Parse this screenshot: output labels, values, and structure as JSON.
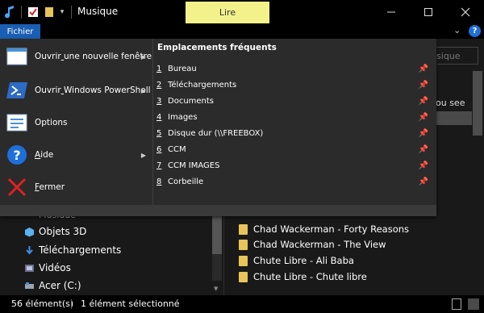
{
  "window": {
    "title": "Musique",
    "contextual_tab": "Lire",
    "icons": [
      "music-note-icon",
      "properties-icon",
      "new-folder-icon",
      "customize-quick-access-icon"
    ]
  },
  "ribbon": {
    "file_tab": "Fichier",
    "help": "?"
  },
  "file_menu": {
    "items": [
      {
        "label": "Ouvrir une nouvelle fenêtre",
        "has_submenu": true
      },
      {
        "label": "Ouvrir Windows PowerShell",
        "has_submenu": true
      },
      {
        "label": "Options",
        "has_submenu": false
      },
      {
        "label": "Aide",
        "has_submenu": true
      },
      {
        "label": "Fermer",
        "has_submenu": false
      }
    ],
    "frequent_title": "Emplacements fréquents",
    "frequent_places": [
      {
        "num": "1",
        "label": "Bureau"
      },
      {
        "num": "2",
        "label": "Téléchargements"
      },
      {
        "num": "3",
        "label": "Documents"
      },
      {
        "num": "4",
        "label": "Images"
      },
      {
        "num": "5",
        "label": "Disque dur (\\\\FREEBOX)"
      },
      {
        "num": "6",
        "label": "CCM"
      },
      {
        "num": "7",
        "label": "CCM IMAGES"
      },
      {
        "num": "8",
        "label": "Corbeille"
      }
    ]
  },
  "background": {
    "search_placeholder": "Rechercher dans : Musique",
    "search_visible": "isique",
    "partial_text": "ou see",
    "partial_nav": "Musique"
  },
  "nav_pane": {
    "items": [
      {
        "label": "Objets 3D",
        "icon": "cube-icon"
      },
      {
        "label": "Téléchargements",
        "icon": "download-icon"
      },
      {
        "label": "Vidéos",
        "icon": "video-icon"
      },
      {
        "label": "Acer (C:)",
        "icon": "drive-icon"
      }
    ]
  },
  "files": {
    "items": [
      "Chad Wackerman - Forty Reasons",
      "Chad Wackerman - The View",
      "Chute Libre - Ali Baba",
      "Chute Libre - Chute libre"
    ]
  },
  "status": {
    "count": "56 élément(s)",
    "selected": "1 élément sélectionné"
  },
  "colors": {
    "accent": "#1a5fb4",
    "contextual": "#f3f28a",
    "folder": "#e8c45a"
  }
}
